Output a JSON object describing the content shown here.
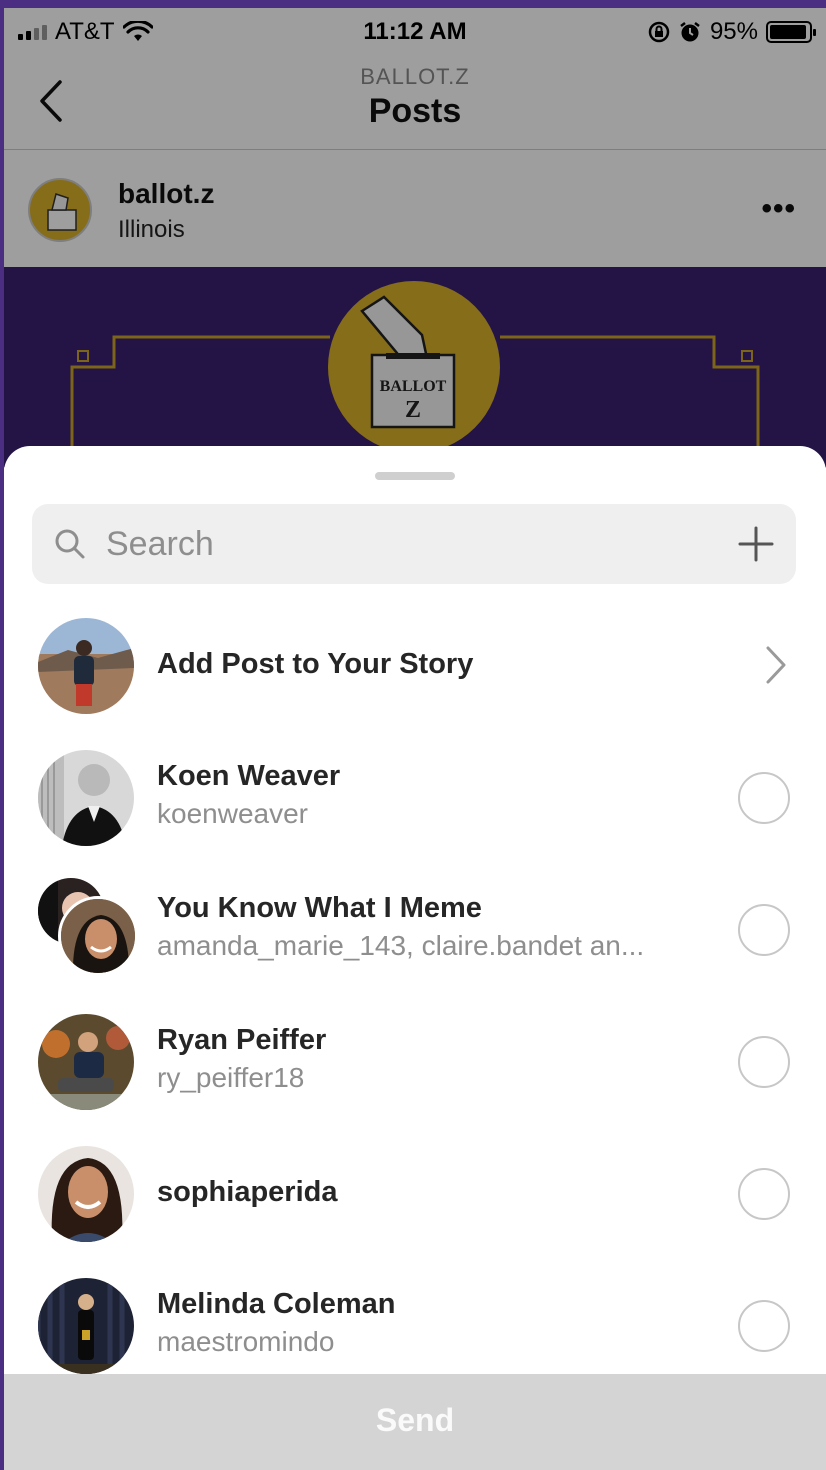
{
  "status_bar": {
    "carrier": "AT&T",
    "time": "11:12 AM",
    "battery": "95%",
    "battery_level": 0.95,
    "icons": [
      "signal-icon",
      "wifi-icon",
      "orientation-lock-icon",
      "alarm-icon",
      "battery-icon"
    ]
  },
  "header": {
    "account": "BALLOT.Z",
    "title": "Posts"
  },
  "post": {
    "username": "ballot.z",
    "location": "Illinois",
    "logo_text_1": "BALLOT",
    "logo_text_2": "Z"
  },
  "share_sheet": {
    "search_placeholder": "Search",
    "story_row": {
      "label": "Add Post to Your Story"
    },
    "contacts": [
      {
        "name": "Koen Weaver",
        "username": "koenweaver"
      },
      {
        "name": "You Know What I Meme",
        "username": "amanda_marie_143, claire.bandet an..."
      },
      {
        "name": "Ryan Peiffer",
        "username": "ry_peiffer18"
      },
      {
        "name": "sophiaperida",
        "username": ""
      },
      {
        "name": "Melinda Coleman",
        "username": "maestromindo"
      }
    ],
    "send_label": "Send"
  },
  "colors": {
    "brand_purple": "#4b2e82",
    "logo_gold": "#d9b02a",
    "send_disabled": "#d4d4d4"
  }
}
